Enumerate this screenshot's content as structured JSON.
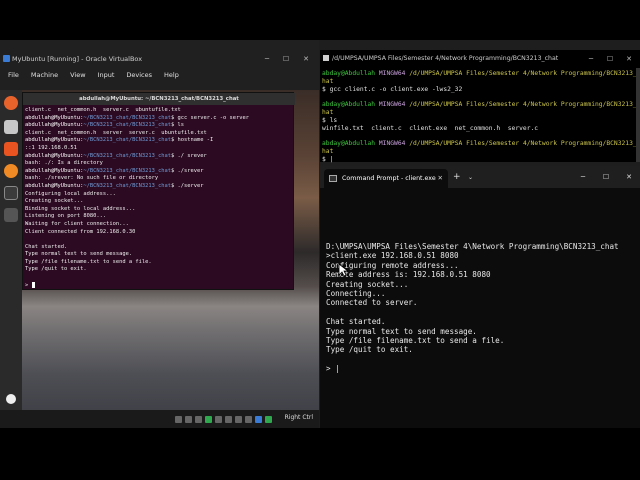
{
  "vbox": {
    "title": "MyUbuntu [Running] - Oracle VirtualBox",
    "menu": [
      "File",
      "Machine",
      "View",
      "Input",
      "Devices",
      "Help"
    ],
    "host_key": "Right Ctrl"
  },
  "ubuntu_terminal": {
    "title": "abdullah@MyUbuntu: ~/BCN3213_chat/BCN3213_chat",
    "lines": [
      {
        "type": "out",
        "text": "client.c  net_common.h  server.c  ubuntufile.txt"
      },
      {
        "type": "prompt",
        "user": "abdullah@MyUbuntu:",
        "path": "~/BCN3213_chat/BCN3213_chat",
        "cmd": "$ gcc server.c -o server"
      },
      {
        "type": "prompt",
        "user": "abdullah@MyUbuntu:",
        "path": "~/BCN3213_chat/BCN3213_chat",
        "cmd": "$ ls"
      },
      {
        "type": "out",
        "text": "client.c  net_common.h  server  server.c  ubuntufile.txt"
      },
      {
        "type": "prompt",
        "user": "abdullah@MyUbuntu:",
        "path": "~/BCN3213_chat/BCN3213_chat",
        "cmd": "$ hostname -I"
      },
      {
        "type": "out",
        "text": "::1 192.168.0.51"
      },
      {
        "type": "prompt",
        "user": "abdullah@MyUbuntu:",
        "path": "~/BCN3213_chat/BCN3213_chat",
        "cmd": "$ ./ srever"
      },
      {
        "type": "out",
        "text": "bash: ./: Is a directory"
      },
      {
        "type": "prompt",
        "user": "abdullah@MyUbuntu:",
        "path": "~/BCN3213_chat/BCN3213_chat",
        "cmd": "$ ./srever"
      },
      {
        "type": "out",
        "text": "bash: ./srever: No such file or directory"
      },
      {
        "type": "prompt",
        "user": "abdullah@MyUbuntu:",
        "path": "~/BCN3213_chat/BCN3213_chat",
        "cmd": "$ ./server"
      },
      {
        "type": "out",
        "text": "Configuring local address..."
      },
      {
        "type": "out",
        "text": "Creating socket..."
      },
      {
        "type": "out",
        "text": "Binding socket to local address..."
      },
      {
        "type": "out",
        "text": "Listening on port 8080..."
      },
      {
        "type": "out",
        "text": "Waiting for client connection..."
      },
      {
        "type": "out",
        "text": "Client connected from 192.168.0.30"
      },
      {
        "type": "out",
        "text": ""
      },
      {
        "type": "out",
        "text": "Chat started."
      },
      {
        "type": "out",
        "text": "Type normal text to send message."
      },
      {
        "type": "out",
        "text": "Type /file filename.txt to send a file."
      },
      {
        "type": "out",
        "text": "Type /quit to exit."
      },
      {
        "type": "out",
        "text": ""
      },
      {
        "type": "out",
        "text": "> "
      }
    ]
  },
  "mingw": {
    "title": "/d/UMPSA/UMPSA Files/Semester 4/Network Programming/BCN3213_chat",
    "lines": [
      {
        "type": "prompt",
        "user": "abday@Abdullah",
        "host": "MINGW64",
        "path": "/d/UMPSA/UMPSA Files/Semester 4/Network Programming/BCN3213_c"
      },
      {
        "type": "out",
        "text": "hat"
      },
      {
        "type": "out",
        "text": "$ gcc client.c -o client.exe -lws2_32"
      },
      {
        "type": "out",
        "text": ""
      },
      {
        "type": "prompt",
        "user": "abday@Abdullah",
        "host": "MINGW64",
        "path": "/d/UMPSA/UMPSA Files/Semester 4/Network Programming/BCN3213_c"
      },
      {
        "type": "out",
        "text": "hat"
      },
      {
        "type": "out",
        "text": "$ ls"
      },
      {
        "type": "out",
        "text": "winfile.txt  client.c  client.exe  net_common.h  server.c"
      },
      {
        "type": "out",
        "text": ""
      },
      {
        "type": "prompt",
        "user": "abday@Abdullah",
        "host": "MINGW64",
        "path": "/d/UMPSA/UMPSA Files/Semester 4/Network Programming/BCN3213_c"
      },
      {
        "type": "out",
        "text": "hat"
      },
      {
        "type": "out",
        "text": "$ |"
      }
    ]
  },
  "cmd": {
    "tab_title": "Command Prompt - client.exe",
    "lines": [
      "D:\\UMPSA\\UMPSA Files\\Semester 4\\Network Programming\\BCN3213_chat",
      ">client.exe 192.168.0.51 8080",
      "Configuring remote address...",
      "Remote address is: 192.168.0.51 8080",
      "Creating socket...",
      "Connecting...",
      "Connected to server.",
      "",
      "Chat started.",
      "Type normal text to send message.",
      "Type /file filename.txt to send a file.",
      "Type /quit to exit.",
      "",
      "> |"
    ]
  },
  "colors": {
    "ubuntu_bg": "#2c0a22",
    "mingw_user": "#3cc63c",
    "mingw_host": "#c9a0dc",
    "mingw_path": "#c9c34a",
    "cmd_bg": "#0c0c0c"
  }
}
